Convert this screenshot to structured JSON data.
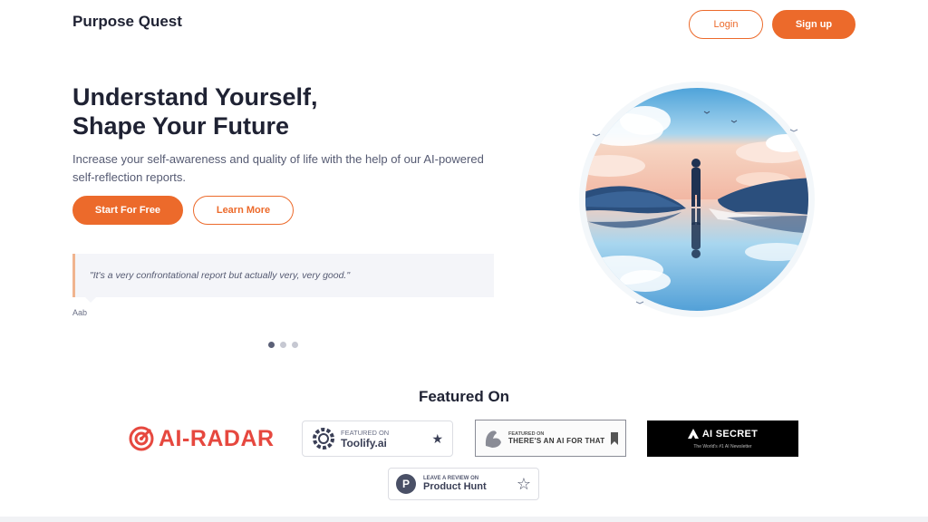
{
  "nav": {
    "logo": "Purpose Quest",
    "login_label": "Login",
    "signup_label": "Sign up"
  },
  "hero": {
    "title_line1": "Understand Yourself,",
    "title_line2": "Shape Your Future",
    "subtitle": "Increase your self-awareness and quality of life with the help of our AI-powered self-reflection reports.",
    "start_label": "Start For Free",
    "learn_label": "Learn More"
  },
  "testimonial": {
    "quote": "\"It's a very confrontational report but actually very, very good.\"",
    "author": "Aab",
    "slide_count": 3,
    "active_slide": 1
  },
  "featured": {
    "title": "Featured On",
    "ai_radar": "AI-RADAR",
    "toolify_small": "FEATURED ON",
    "toolify_big": "Toolify.ai",
    "aifor_small": "FEATURED ON",
    "aifor_big": "THERE'S AN AI FOR THAT",
    "aisecret_big": "AI SECRET",
    "aisecret_small": "The World's #1 AI Newsletter",
    "ph_small": "LEAVE A REVIEW ON",
    "ph_big": "Product Hunt"
  },
  "colors": {
    "accent": "#ec6a2b",
    "text_dark": "#1f2233",
    "ai_radar_red": "#e6483f"
  }
}
